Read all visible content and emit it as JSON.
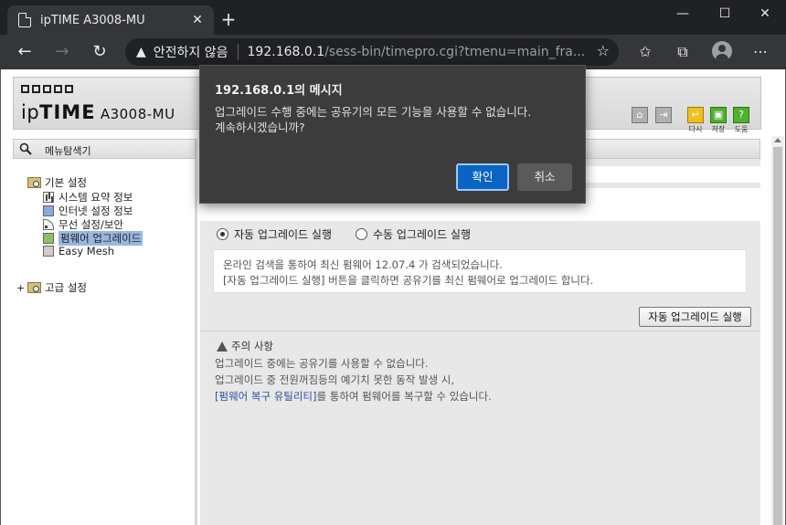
{
  "browser": {
    "tab_title": "ipTIME A3008-MU",
    "tab_close": "✕",
    "new_tab": "+",
    "security_label": "안전하지 않음",
    "url_host": "192.168.0.1",
    "url_path": "/sess-bin/timepro.cgi?tmenu=main_fra...",
    "minimize": "—",
    "maximize": "☐",
    "close": "✕"
  },
  "header": {
    "logo_brand_prefix": "ip",
    "logo_brand": "TIME",
    "logo_model": " A3008-MU",
    "icon_labels": {
      "back": "다시",
      "save": "저장",
      "help": "도움"
    }
  },
  "sidebar": {
    "title": "메뉴탐색기",
    "basic_settings": "기본 설정",
    "items": [
      {
        "label": "시스템 요약 정보"
      },
      {
        "label": "인터넷 설정 정보"
      },
      {
        "label": "무선 설정/보안"
      },
      {
        "label": "펌웨어 업그레이드"
      },
      {
        "label": "Easy Mesh"
      }
    ],
    "advanced_prefix": "+",
    "advanced_settings": "고급 설정"
  },
  "main": {
    "radio_auto": "자동 업그레이드 실행",
    "radio_manual": "수동 업그레이드 실행",
    "info_line1": "온라인 검색을 통하여 최신 펌웨어 12.07.4 가 검색되었습니다.",
    "info_line2": "[자동 업그레이드 실행] 버튼을 클릭하면 공유기를 최신 펌웨어로 업그레이드 합니다.",
    "auto_button": "자동 업그레이드 실행",
    "notice_title": "주의 사항",
    "notice_line1": "업그레이드 중에는 공유기를 사용할 수 없습니다.",
    "notice_line2": "업그레이드 중 전원꺼짐등의 예기치 못한 동작 발생 시,",
    "notice_link": "[펌웨어 복구 유틸리티]",
    "notice_line3_rest": "를 통하여 펌웨어를 복구할 수 있습니다."
  },
  "dialog": {
    "title": "192.168.0.1의 메시지",
    "message_line1": "업그레이드 수행 중에는 공유기의 모든 기능을 사용할 수 없습니다.",
    "message_line2": "계속하시겠습니까?",
    "ok": "확인",
    "cancel": "취소"
  }
}
